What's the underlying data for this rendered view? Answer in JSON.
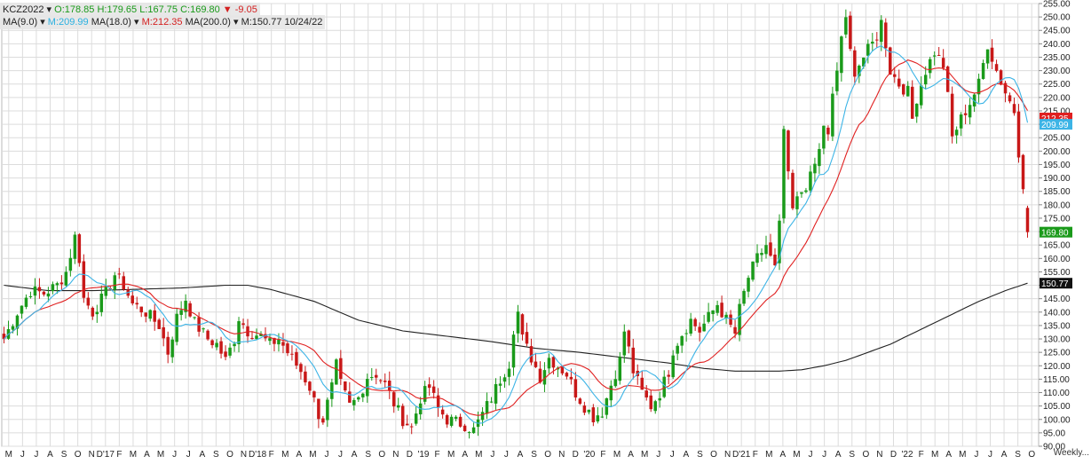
{
  "header": {
    "symbol": "KCZ2022",
    "open": "O:178.85",
    "high": "H:179.65",
    "low": "L:167.75",
    "close": "C:169.80",
    "change": "-9.05",
    "ma1_name": "MA(9.0)",
    "ma1_value": "M:209.99",
    "ma2_name": "MA(18.0)",
    "ma2_value": "M:212.35",
    "ma3_name": "MA(200.0)",
    "ma3_value": "M:150.77",
    "date": "10/24/22",
    "dropdown_glyph": "▾",
    "down_glyph": "▼"
  },
  "timeframe_label": "Weekly...",
  "colors": {
    "up": "#1a9a1a",
    "down": "#c81818",
    "ma1": "#3cb4e6",
    "ma2": "#e02020",
    "ma3": "#222222",
    "grid": "#dcdcdc"
  },
  "chart_data": {
    "type": "candlestick",
    "y_axis": {
      "min": 90,
      "max": 255,
      "step": 5,
      "tick_labels": [
        "90.00",
        "95.00",
        "100.00",
        "105.00",
        "110.00",
        "115.00",
        "120.00",
        "125.00",
        "130.00",
        "135.00",
        "140.00",
        "145.00",
        "150.00",
        "155.00",
        "160.00",
        "165.00",
        "170.00",
        "175.00",
        "180.00",
        "185.00",
        "190.00",
        "195.00",
        "200.00",
        "205.00",
        "210.00",
        "215.00",
        "220.00",
        "225.00",
        "230.00",
        "235.00",
        "240.00",
        "245.00",
        "250.00",
        "255.00"
      ],
      "position": "right"
    },
    "x_axis": {
      "tick_labels": [
        "M",
        "J",
        "J",
        "A",
        "S",
        "O",
        "N",
        "D'17",
        "F",
        "M",
        "A",
        "M",
        "J",
        "J",
        "A",
        "S",
        "O",
        "N",
        "D'18",
        "F",
        "M",
        "A",
        "M",
        "J",
        "J",
        "A",
        "S",
        "O",
        "N",
        "D",
        "'19",
        "F",
        "M",
        "A",
        "M",
        "J",
        "J",
        "A",
        "S",
        "O",
        "N",
        "D",
        "'20",
        "F",
        "M",
        "A",
        "M",
        "J",
        "J",
        "A",
        "S",
        "O",
        "N",
        "D'21",
        "F",
        "M",
        "A",
        "M",
        "J",
        "J",
        "A",
        "S",
        "O",
        "N",
        "D",
        "'22",
        "F",
        "M",
        "A",
        "M",
        "J",
        "J",
        "A",
        "S",
        "O"
      ]
    },
    "grid": true,
    "price_labels": [
      {
        "value": 212.35,
        "text": "212.35",
        "color": "#e02020"
      },
      {
        "value": 209.99,
        "text": "209.99",
        "color": "#3cb4e6"
      },
      {
        "value": 169.8,
        "text": "169.80",
        "color": "#1a9a1a"
      },
      {
        "value": 150.77,
        "text": "150.77",
        "color": "#111111"
      }
    ],
    "price_path": [
      [
        0,
        130
      ],
      [
        3,
        140
      ],
      [
        6,
        148
      ],
      [
        9,
        147
      ],
      [
        12,
        150
      ],
      [
        14,
        155
      ],
      [
        16,
        168
      ],
      [
        17,
        160
      ],
      [
        18,
        145
      ],
      [
        20,
        140
      ],
      [
        23,
        147
      ],
      [
        25,
        154
      ],
      [
        27,
        150
      ],
      [
        29,
        143
      ],
      [
        32,
        140
      ],
      [
        35,
        135
      ],
      [
        37,
        125
      ],
      [
        39,
        138
      ],
      [
        41,
        145
      ],
      [
        43,
        136
      ],
      [
        46,
        130
      ],
      [
        48,
        128
      ],
      [
        50,
        122
      ],
      [
        52,
        130
      ],
      [
        53,
        138
      ],
      [
        55,
        133
      ],
      [
        58,
        131
      ],
      [
        60,
        128
      ],
      [
        62,
        130
      ],
      [
        64,
        125
      ],
      [
        67,
        118
      ],
      [
        69,
        112
      ],
      [
        71,
        102
      ],
      [
        72,
        100
      ],
      [
        74,
        112
      ],
      [
        75,
        120
      ],
      [
        76,
        113
      ],
      [
        78,
        105
      ],
      [
        80,
        108
      ],
      [
        82,
        116
      ],
      [
        84,
        117
      ],
      [
        86,
        113
      ],
      [
        88,
        106
      ],
      [
        90,
        100
      ],
      [
        92,
        97
      ],
      [
        94,
        108
      ],
      [
        96,
        112
      ],
      [
        98,
        104
      ],
      [
        100,
        100
      ],
      [
        102,
        99
      ],
      [
        104,
        98
      ],
      [
        106,
        96
      ],
      [
        108,
        102
      ],
      [
        110,
        108
      ],
      [
        112,
        115
      ],
      [
        114,
        121
      ],
      [
        115,
        134
      ],
      [
        116,
        140
      ],
      [
        117,
        130
      ],
      [
        119,
        123
      ],
      [
        121,
        116
      ],
      [
        123,
        123
      ],
      [
        125,
        120
      ],
      [
        127,
        117
      ],
      [
        129,
        110
      ],
      [
        131,
        105
      ],
      [
        133,
        101
      ],
      [
        135,
        103
      ],
      [
        137,
        113
      ],
      [
        139,
        122
      ],
      [
        140,
        133
      ],
      [
        141,
        126
      ],
      [
        142,
        118
      ],
      [
        144,
        110
      ],
      [
        146,
        105
      ],
      [
        148,
        110
      ],
      [
        150,
        118
      ],
      [
        151,
        126
      ],
      [
        153,
        132
      ],
      [
        155,
        137
      ],
      [
        157,
        133
      ],
      [
        159,
        138
      ],
      [
        161,
        143
      ],
      [
        163,
        137
      ],
      [
        165,
        132
      ],
      [
        166,
        141
      ],
      [
        168,
        153
      ],
      [
        170,
        160
      ],
      [
        172,
        165
      ],
      [
        173,
        160
      ],
      [
        174,
        156
      ],
      [
        175,
        172
      ],
      [
        176,
        208
      ],
      [
        177,
        190
      ],
      [
        178,
        178
      ],
      [
        180,
        185
      ],
      [
        182,
        190
      ],
      [
        184,
        200
      ],
      [
        185,
        210
      ],
      [
        186,
        205
      ],
      [
        187,
        220
      ],
      [
        188,
        230
      ],
      [
        189,
        243
      ],
      [
        190,
        248
      ],
      [
        191,
        237
      ],
      [
        192,
        230
      ],
      [
        194,
        235
      ],
      [
        196,
        240
      ],
      [
        197,
        243
      ],
      [
        198,
        248
      ],
      [
        199,
        240
      ],
      [
        200,
        230
      ],
      [
        202,
        225
      ],
      [
        204,
        222
      ],
      [
        205,
        212
      ],
      [
        206,
        220
      ],
      [
        208,
        230
      ],
      [
        210,
        237
      ],
      [
        212,
        232
      ],
      [
        213,
        220
      ],
      [
        214,
        205
      ],
      [
        216,
        212
      ],
      [
        218,
        218
      ],
      [
        220,
        225
      ],
      [
        222,
        240
      ],
      [
        224,
        230
      ],
      [
        226,
        222
      ],
      [
        228,
        215
      ],
      [
        229,
        200
      ],
      [
        230,
        188
      ],
      [
        231,
        169.8
      ]
    ],
    "series": [
      {
        "name": "MA(9.0)",
        "value": 209.99
      },
      {
        "name": "MA(18.0)",
        "value": 212.35
      },
      {
        "name": "MA(200.0)",
        "value": 150.77
      }
    ],
    "ma200_path": [
      [
        0,
        150
      ],
      [
        10,
        148
      ],
      [
        20,
        148
      ],
      [
        30,
        148.5
      ],
      [
        40,
        149
      ],
      [
        50,
        150
      ],
      [
        55,
        150
      ],
      [
        60,
        148.5
      ],
      [
        70,
        144
      ],
      [
        80,
        137
      ],
      [
        90,
        133
      ],
      [
        100,
        131
      ],
      [
        110,
        129
      ],
      [
        120,
        126.5
      ],
      [
        130,
        125
      ],
      [
        140,
        123
      ],
      [
        150,
        121
      ],
      [
        158,
        119
      ],
      [
        165,
        118
      ],
      [
        175,
        118
      ],
      [
        180,
        118.5
      ],
      [
        185,
        120
      ],
      [
        190,
        122
      ],
      [
        200,
        128
      ],
      [
        210,
        136
      ],
      [
        220,
        144
      ],
      [
        226,
        148
      ],
      [
        231,
        150.77
      ]
    ]
  }
}
